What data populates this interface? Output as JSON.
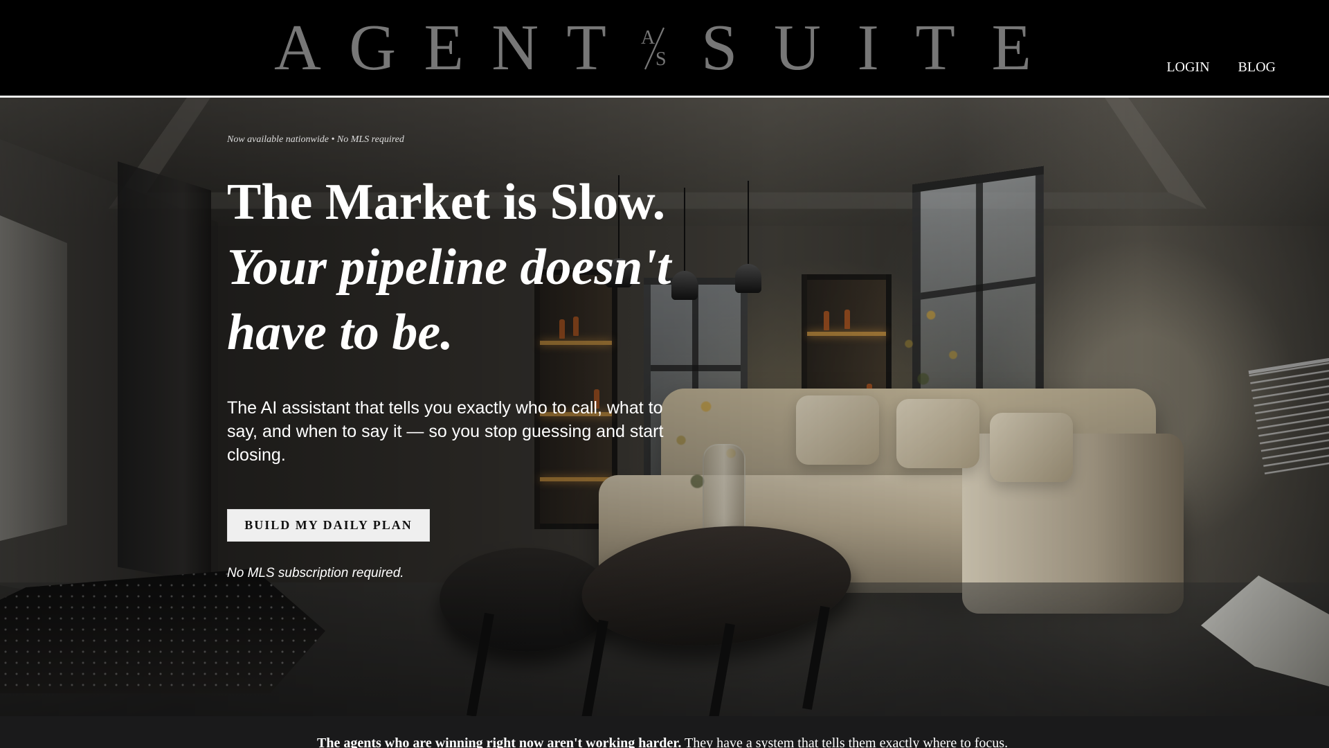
{
  "brand": {
    "left_letters": [
      "A",
      "G",
      "E",
      "N",
      "T"
    ],
    "mark_letters": [
      "A",
      "S"
    ],
    "right_letters": [
      "S",
      "U",
      "I",
      "T",
      "E"
    ],
    "logo_color": "#777777"
  },
  "nav": {
    "login": "LOGIN",
    "blog": "BLOG"
  },
  "hero": {
    "eyebrow": "Now available nationwide • No MLS required",
    "headline_line_1": "The Market is Slow.",
    "headline_line_2": "Your pipeline doesn't",
    "headline_line_3": "have to be.",
    "subcopy": "The AI assistant that tells you exactly who to call, what to say, and when to say it — so you stop guessing and start closing.",
    "cta_label": "BUILD MY DAILY PLAN",
    "note": "No MLS subscription required."
  },
  "statement": {
    "strong": "The agents who are winning right now aren't working harder.",
    "rest": "They have a system that tells them exactly where to focus."
  },
  "colors": {
    "header_background": "#000000",
    "header_border": "#f2f2f2",
    "cta_background": "#efefef",
    "bottom_background": "#1a1a1b"
  },
  "icons": {
    "logo_monogram": "as-monogram-icon"
  }
}
